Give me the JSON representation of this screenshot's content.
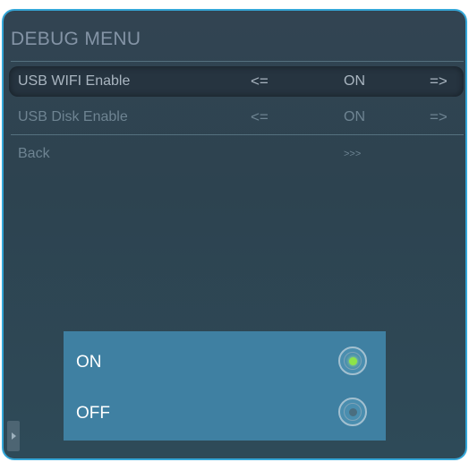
{
  "menu": {
    "title": "DEBUG MENU",
    "items": [
      {
        "label": "USB WIFI Enable",
        "left_arrow": "<=",
        "value": "ON",
        "right_arrow": "=>"
      },
      {
        "label": "USB Disk Enable",
        "left_arrow": "<=",
        "value": "ON",
        "right_arrow": "=>"
      },
      {
        "label": "Back",
        "value": ">>>"
      }
    ]
  },
  "popup": {
    "options": [
      {
        "label": "ON",
        "selected": true
      },
      {
        "label": "OFF",
        "selected": false
      }
    ]
  },
  "colors": {
    "frame_border": "#35a7d8",
    "background": "#2e4552",
    "popup": "#3f80a2",
    "radio_selected": "#8de34a"
  }
}
